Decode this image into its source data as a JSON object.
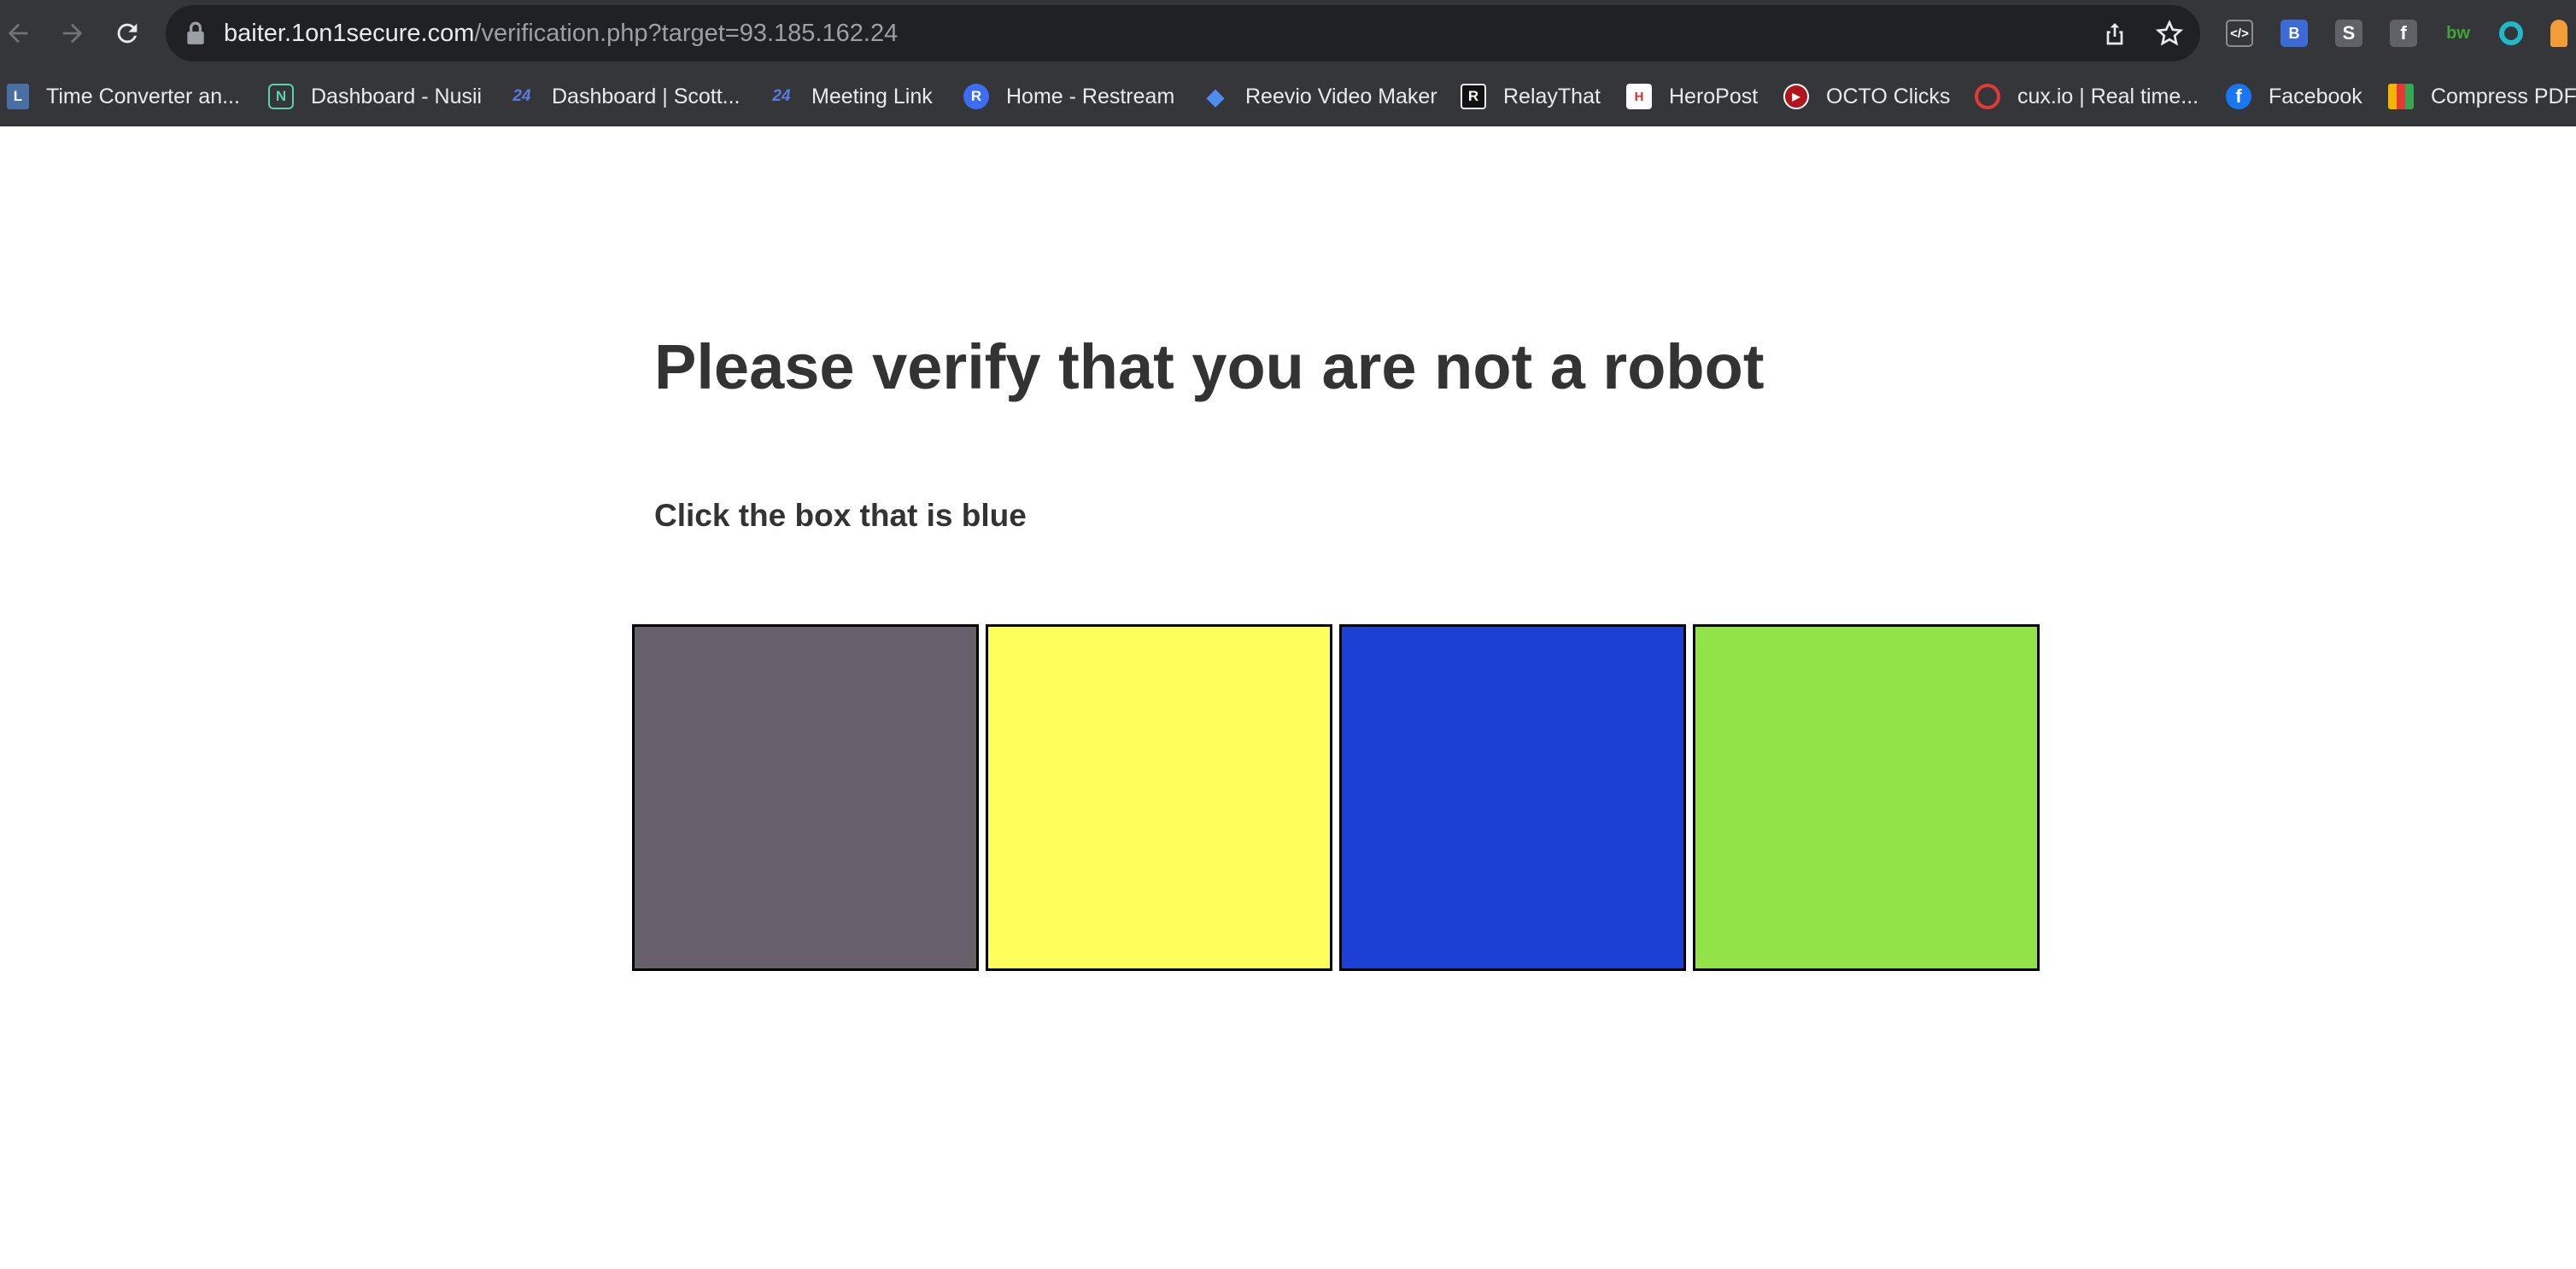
{
  "browser": {
    "url_host": "baiter.1on1secure.com",
    "url_path": "/verification.php?target=93.185.162.24",
    "icons": {
      "back": "back-arrow-icon",
      "forward": "forward-arrow-icon",
      "reload": "reload-icon",
      "lock": "lock-icon",
      "share": "share-icon",
      "star": "bookmark-star-icon"
    },
    "extensions": [
      {
        "name": "code-extension-icon",
        "glyph": "</>",
        "color": "#5f6368"
      },
      {
        "name": "b-extension-icon",
        "glyph": "B",
        "color": "#3b6bd6"
      },
      {
        "name": "s-extension-icon",
        "glyph": "S",
        "color": "#5f6368"
      },
      {
        "name": "facebook-extension-icon",
        "glyph": "f",
        "color": "#5f6368"
      },
      {
        "name": "bw-extension-icon",
        "glyph": "bw",
        "color": "#35363a"
      },
      {
        "name": "circle-extension-icon",
        "glyph": "",
        "color": "#1fb9c9"
      },
      {
        "name": "key-extension-icon",
        "glyph": "",
        "color": "#f29d38"
      }
    ]
  },
  "bookmarks": [
    {
      "label": "Time Converter an...",
      "icon": "time-converter-icon",
      "icon_text": "L",
      "icon_color": "#4a6fa5"
    },
    {
      "label": "Dashboard - Nusii",
      "icon": "nusii-icon",
      "icon_text": "N",
      "icon_color": "#35363a"
    },
    {
      "label": "Dashboard | Scott...",
      "icon": "24-icon",
      "icon_text": "24",
      "icon_color": "#35363a"
    },
    {
      "label": "Meeting Link",
      "icon": "24-icon",
      "icon_text": "24",
      "icon_color": "#35363a"
    },
    {
      "label": "Home - Restream",
      "icon": "restream-icon",
      "icon_text": "R",
      "icon_color": "#3d6df2"
    },
    {
      "label": "Reevio Video Maker",
      "icon": "reevio-icon",
      "icon_text": "◆",
      "icon_color": "#35363a"
    },
    {
      "label": "RelayThat",
      "icon": "relaythat-icon",
      "icon_text": "R",
      "icon_color": "#111111"
    },
    {
      "label": "HeroPost",
      "icon": "heropost-icon",
      "icon_text": "H",
      "icon_color": "#ffffff"
    },
    {
      "label": "OCTO Clicks",
      "icon": "octo-clicks-icon",
      "icon_text": "▶",
      "icon_color": "#b0151b"
    },
    {
      "label": "cux.io | Real time...",
      "icon": "cux-icon",
      "icon_text": "c",
      "icon_color": "#e53935"
    },
    {
      "label": "Facebook",
      "icon": "facebook-icon",
      "icon_text": "f",
      "icon_color": "#1877f2"
    },
    {
      "label": "Compress PDF",
      "icon": "compress-pdf-icon",
      "icon_text": "",
      "icon_color": "#f4b400"
    }
  ],
  "page": {
    "title": "Please verify that you are not a robot",
    "instruction": "Click the box that is blue",
    "boxes": [
      {
        "name": "gray-box",
        "color": "#67606b"
      },
      {
        "name": "yellow-box",
        "color": "#ffff5c"
      },
      {
        "name": "blue-box",
        "color": "#1c40d4"
      },
      {
        "name": "green-box",
        "color": "#92e347"
      }
    ]
  }
}
